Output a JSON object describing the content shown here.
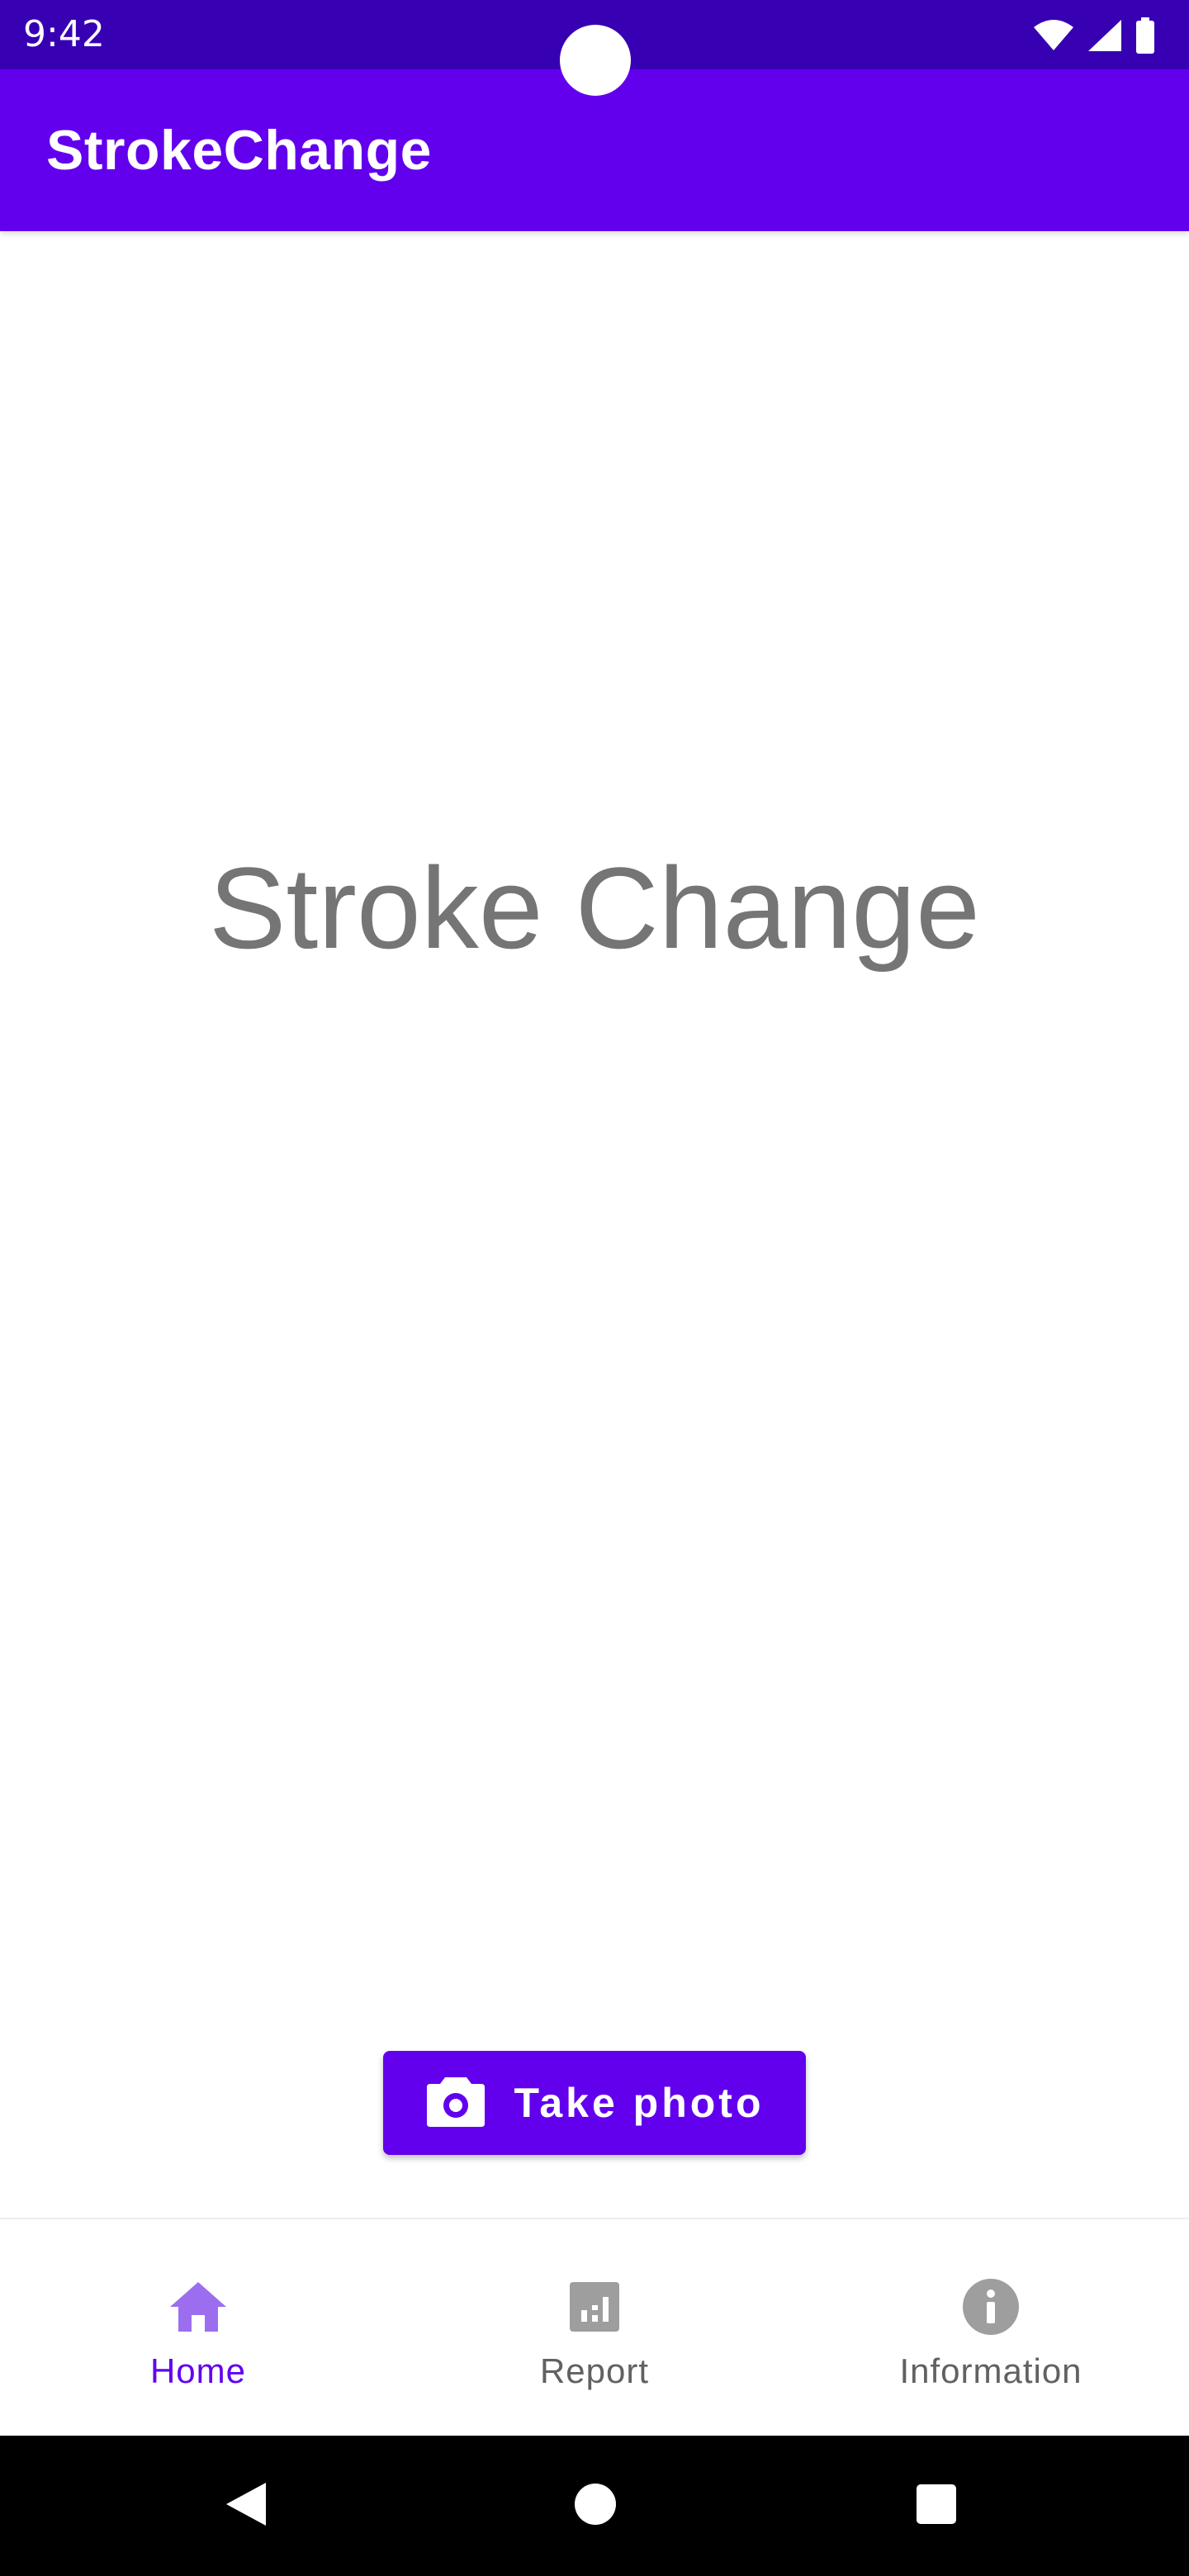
{
  "status_bar": {
    "time": "9:42",
    "icons": [
      "wifi-icon",
      "cell-signal-icon",
      "battery-icon"
    ]
  },
  "app_bar": {
    "title": "StrokeChange"
  },
  "main": {
    "title": "Stroke Change",
    "take_photo": {
      "label": "Take photo",
      "icon": "camera-icon"
    }
  },
  "bottom_nav": {
    "items": [
      {
        "label": "Home",
        "icon": "home-icon",
        "active": true
      },
      {
        "label": "Report",
        "icon": "report-chart-icon",
        "active": false
      },
      {
        "label": "Information",
        "icon": "info-icon",
        "active": false
      }
    ]
  },
  "system_nav": {
    "buttons": [
      "back-icon",
      "home-circle-icon",
      "recents-icon"
    ]
  },
  "colors": {
    "status_bar": "#3700B3",
    "primary": "#6200EE",
    "title_gray": "#757575",
    "nav_inactive": "#616161",
    "nav_active_icon": "#9C6EEF"
  }
}
